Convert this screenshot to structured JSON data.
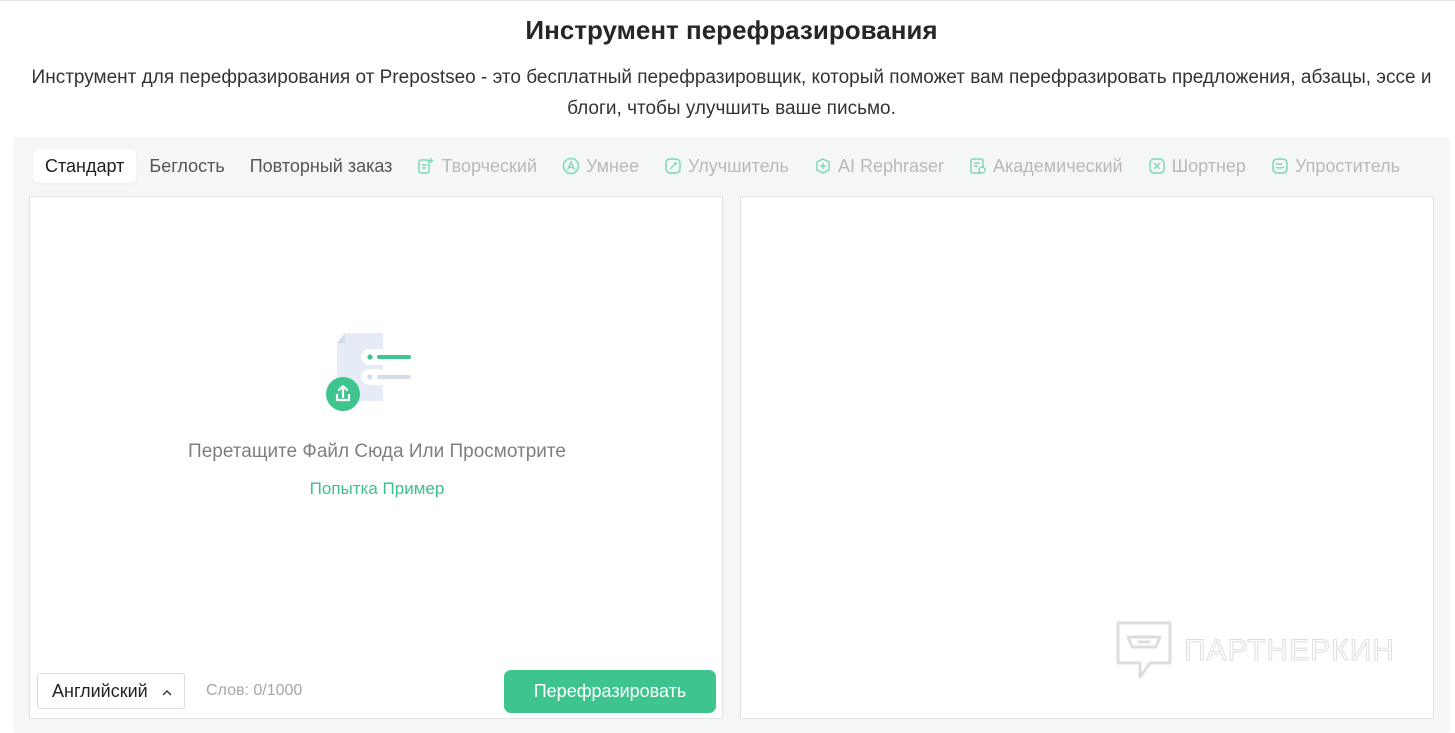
{
  "header": {
    "title": "Инструмент перефразирования",
    "subtitle": "Инструмент для перефразирования от Prepostseo - это бесплатный перефразировщик, который поможет вам перефразировать предложения, абзацы, эссе и блоги, чтобы улучшить ваше письмо."
  },
  "tabs": [
    {
      "label": "Стандарт",
      "active": true
    },
    {
      "label": "Беглость"
    },
    {
      "label": "Повторный заказ"
    },
    {
      "label": "Творческий",
      "icon": "creative-icon"
    },
    {
      "label": "Умнее",
      "icon": "smarter-icon"
    },
    {
      "label": "Улучшитель",
      "icon": "improver-icon"
    },
    {
      "label": "AI Rephraser",
      "icon": "ai-rephraser-icon"
    },
    {
      "label": "Академический",
      "icon": "academic-icon"
    },
    {
      "label": "Шортнер",
      "icon": "shortener-icon"
    },
    {
      "label": "Упроститель",
      "icon": "simplifier-icon"
    }
  ],
  "input": {
    "drop_text": "Перетащите Файл Сюда Или Просмотрите",
    "sample_link": "Попытка Пример",
    "language": "Английский",
    "word_count": "Слов: 0/1000",
    "submit_label": "Перефразировать"
  },
  "watermark": {
    "text": "ПАРТНЕРКИН"
  },
  "colors": {
    "accent": "#3ec58d",
    "link": "#3fbf8a",
    "pro_tab": "#b9b9b9"
  }
}
